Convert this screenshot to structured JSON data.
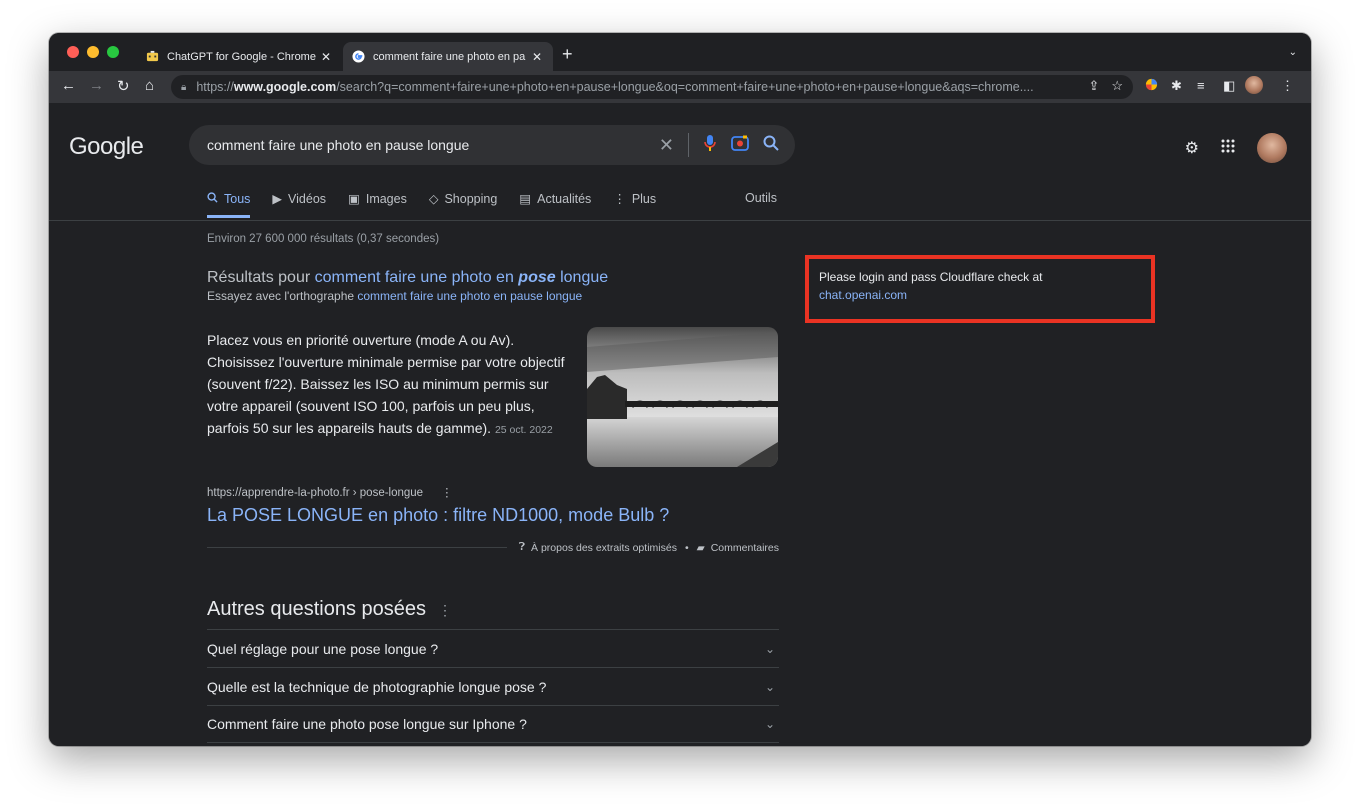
{
  "browser": {
    "tabs": [
      {
        "title": "ChatGPT for Google - Chrome",
        "active": false
      },
      {
        "title": "comment faire une photo en pa",
        "active": true
      }
    ],
    "new_tab_symbol": "+",
    "url_prefix": "https://",
    "url_host": "www.google.com",
    "url_rest": "/search?q=comment+faire+une+photo+en+pause+longue&oq=comment+faire+une+photo+en+pause+longue&aqs=chrome...."
  },
  "google": {
    "logo": "Google",
    "query": "comment faire une photo en pause longue",
    "tabs": [
      "Tous",
      "Vidéos",
      "Images",
      "Shopping",
      "Actualités",
      "Plus"
    ],
    "tools": "Outils",
    "stats": "Environ 27 600 000 résultats (0,37 secondes)",
    "spell": {
      "prefix": "Résultats pour ",
      "corrected_a": "comment faire une photo en ",
      "corrected_em": "pose",
      "corrected_b": " longue",
      "try_prefix": "Essayez avec l'orthographe ",
      "original": "comment faire une photo en pause longue"
    },
    "snippet": {
      "text": "Placez vous en priorité ouverture (mode A ou Av). Choisissez l'ouverture minimale permise par votre objectif (souvent f/22). Baissez les ISO au minimum permis sur votre appareil (souvent ISO 100, parfois un peu plus, parfois 50 sur les appareils hauts de gamme).",
      "date": "25 oct. 2022"
    },
    "result": {
      "source": "https://apprendre-la-photo.fr › pose-longue",
      "title": "La POSE LONGUE en photo : filtre ND1000, mode Bulb ?"
    },
    "featured": {
      "about": "À propos des extraits optimisés",
      "bullet": "•",
      "feedback": "Commentaires"
    },
    "paa": {
      "title": "Autres questions posées",
      "questions": [
        "Quel réglage pour une pose longue ?",
        "Quelle est la technique de photographie longue pose ?",
        "Comment faire une photo pose longue sur Iphone ?"
      ]
    }
  },
  "extension": {
    "message": "Please login and pass Cloudflare check at",
    "link": "chat.openai.com",
    "border_color": "#ea3323"
  },
  "colors": {
    "link": "#8ab4f8",
    "background": "#202124"
  }
}
